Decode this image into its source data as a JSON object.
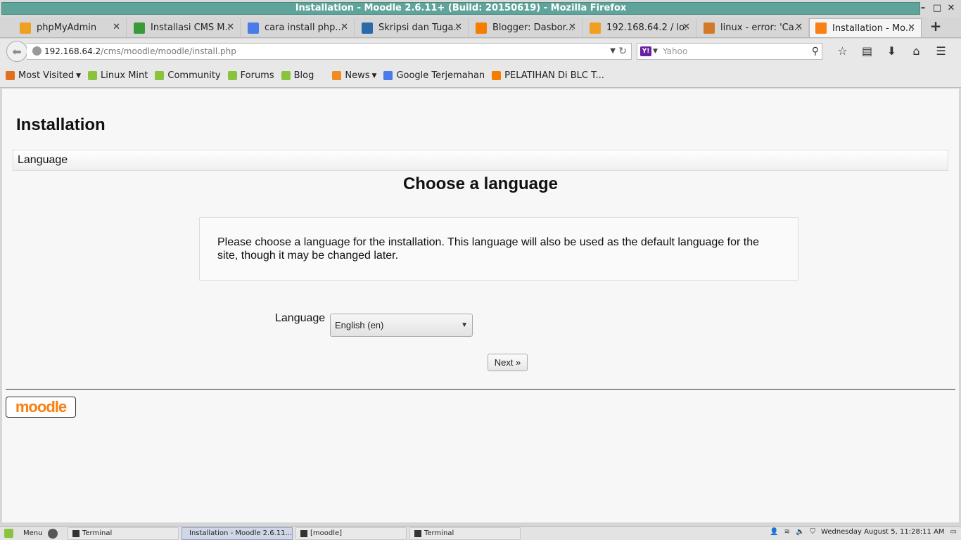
{
  "window": {
    "title": "Installation - Moodle 2.6.11+ (Build: 20150619) - Mozilla Firefox",
    "controls": [
      "minimize-icon",
      "maximize-icon",
      "close-icon"
    ]
  },
  "tabs": [
    {
      "label": "phpMyAdmin",
      "icon": "phpmyadmin-icon",
      "icon_color": "#f0a020",
      "active": false
    },
    {
      "label": "Installasi CMS M...",
      "icon": "page-icon",
      "icon_color": "#3a9a3a",
      "active": false
    },
    {
      "label": "cara install php...",
      "icon": "google-icon",
      "icon_color": "#4a7be8",
      "active": false
    },
    {
      "label": "Skripsi dan Tuga...",
      "icon": "globe-icon",
      "icon_color": "#2a6aa8",
      "active": false
    },
    {
      "label": "Blogger: Dasbor...",
      "icon": "blogger-icon",
      "icon_color": "#f57d00",
      "active": false
    },
    {
      "label": "192.168.64.2 / lo...",
      "icon": "phpmyadmin-icon",
      "icon_color": "#f0a020",
      "active": false
    },
    {
      "label": "linux - error: 'Ca...",
      "icon": "stackoverflow-icon",
      "icon_color": "#d37a2a",
      "active": false
    },
    {
      "label": "Installation - Mo...",
      "icon": "moodle-icon",
      "icon_color": "#f98012",
      "active": true
    }
  ],
  "navbar": {
    "url_host": "192.168.64.2",
    "url_path": "/cms/moodle/moodle/install.php",
    "search_placeholder": "Yahoo",
    "search_engine": "Y!"
  },
  "bookmarks": [
    {
      "label": "Most Visited",
      "icon_color": "#e07020",
      "dropdown": true
    },
    {
      "label": "Linux Mint",
      "icon_color": "#8ac43f",
      "dropdown": false
    },
    {
      "label": "Community",
      "icon_color": "#8ac43f",
      "dropdown": false
    },
    {
      "label": "Forums",
      "icon_color": "#8ac43f",
      "dropdown": false
    },
    {
      "label": "Blog",
      "icon_color": "#8ac43f",
      "dropdown": false
    },
    {
      "label": "News",
      "icon_color": "#f08a24",
      "dropdown": true
    },
    {
      "label": "Google Terjemahan",
      "icon_color": "#4a7be8",
      "dropdown": false
    },
    {
      "label": "PELATIHAN Di BLC T...",
      "icon_color": "#f57d00",
      "dropdown": false
    }
  ],
  "page": {
    "heading": "Installation",
    "section_label": "Language",
    "choose_heading": "Choose a language",
    "info_text": "Please choose a language for the installation. This language will also be used as the default language for the site, though it may be changed later.",
    "language_label": "Language",
    "language_selected": "English (en)",
    "next_button": "Next »",
    "logo_text": "moodle"
  },
  "taskbar": {
    "menu_label": "Menu",
    "items": [
      {
        "label": "Terminal",
        "active": false
      },
      {
        "label": "Installation - Moodle 2.6.11...",
        "active": true
      },
      {
        "label": "[moodle]",
        "active": false
      },
      {
        "label": "Terminal",
        "active": false
      }
    ],
    "clock": "Wednesday August  5, 11:28:11 AM"
  }
}
